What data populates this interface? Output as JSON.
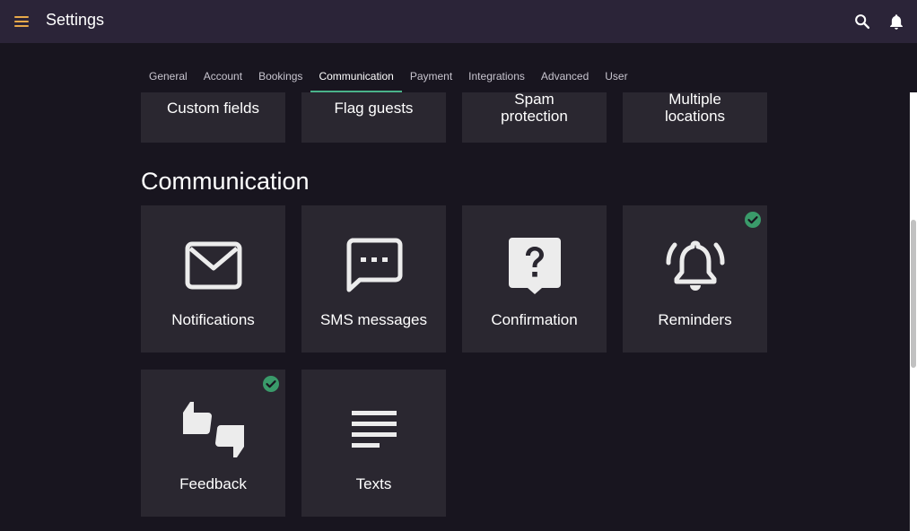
{
  "app": {
    "title": "Settings"
  },
  "tabs": [
    {
      "label": "General"
    },
    {
      "label": "Account"
    },
    {
      "label": "Bookings"
    },
    {
      "label": "Communication",
      "active": true
    },
    {
      "label": "Payment"
    },
    {
      "label": "Integrations"
    },
    {
      "label": "Advanced"
    },
    {
      "label": "User"
    }
  ],
  "previous_section": {
    "cards": [
      {
        "label": "Custom fields"
      },
      {
        "label_line1": "Flag guests"
      },
      {
        "label_line1": "Spam",
        "label_line2": "protection"
      },
      {
        "label_line1": "Multiple",
        "label_line2": "locations"
      }
    ]
  },
  "communication": {
    "title": "Communication",
    "cards": [
      {
        "label": "Notifications",
        "icon": "envelope-icon",
        "enabled": false
      },
      {
        "label": "SMS messages",
        "icon": "message-icon",
        "enabled": false
      },
      {
        "label": "Confirmation",
        "icon": "question-icon",
        "enabled": false
      },
      {
        "label": "Reminders",
        "icon": "alarm-bell-icon",
        "enabled": true
      },
      {
        "label": "Feedback",
        "icon": "thumbs-icon",
        "enabled": true
      },
      {
        "label": "Texts",
        "icon": "text-lines-icon",
        "enabled": false
      }
    ]
  },
  "colors": {
    "topbar": "#2b2438",
    "background": "#18151f",
    "card": "#2a2730",
    "accent_menu": "#e8a94a",
    "tab_indicator": "#4ab38a",
    "check": "#3a9a6a"
  }
}
